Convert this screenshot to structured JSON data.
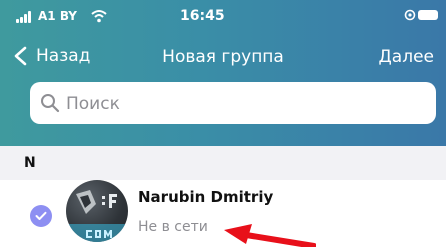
{
  "status_bar": {
    "carrier": "A1 BY",
    "time": "16:45",
    "icons": [
      "signal-icon",
      "wifi-icon",
      "location-icon",
      "battery-icon"
    ]
  },
  "nav": {
    "back_label": "Назад",
    "title": "Новая группа",
    "next_label": "Далее"
  },
  "search": {
    "placeholder": "Поиск",
    "value": ""
  },
  "section": {
    "letter": "N"
  },
  "contacts": [
    {
      "name": "Narubin Dmitriy",
      "status": "Не в сети",
      "selected": true
    }
  ],
  "colors": {
    "header_start": "#3f9a9e",
    "header_end": "#3a78a8",
    "check": "#8d8ff2",
    "annotation_arrow": "#e8101a"
  }
}
